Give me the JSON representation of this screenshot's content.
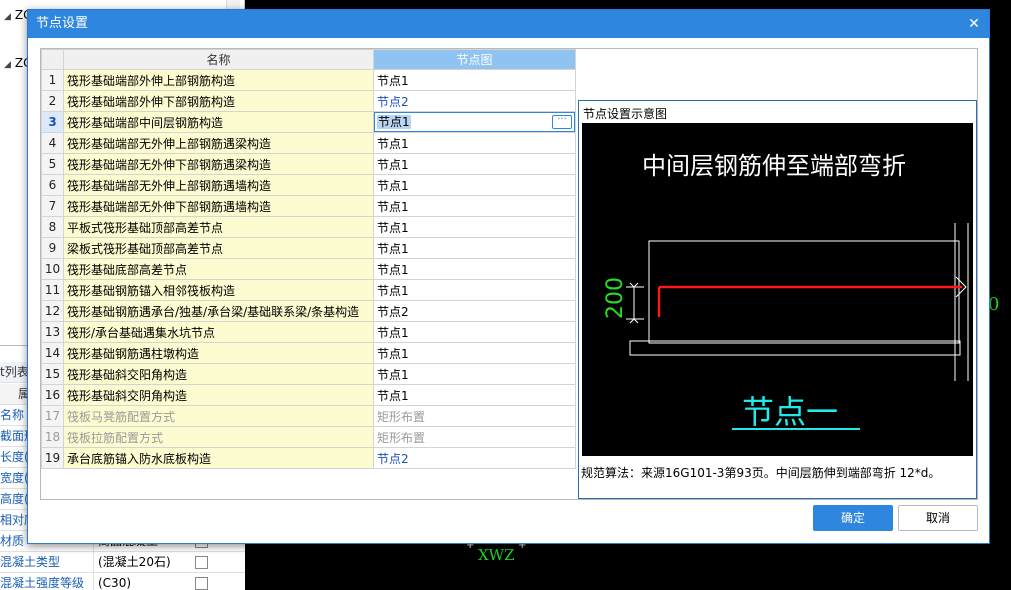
{
  "background": {
    "tree": [
      {
        "label": "ZC"
      },
      {
        "label": "ZC"
      }
    ],
    "panel_header": "t列表",
    "panel_col": "属",
    "rows": [
      {
        "name": "名称",
        "value": ""
      },
      {
        "name": "截面形",
        "value": ""
      },
      {
        "name": "长度(r",
        "value": ""
      },
      {
        "name": "宽度(r",
        "value": ""
      },
      {
        "name": "高度(r",
        "value": ""
      },
      {
        "name": "相对底",
        "value": ""
      },
      {
        "name": "材质",
        "value": "商品混凝土"
      },
      {
        "name": "混凝土类型",
        "value": "(混凝土20石)"
      },
      {
        "name": "混凝土强度等级",
        "value": "(C30)"
      }
    ],
    "canvas_label": "XWZ",
    "canvas_edge": "0"
  },
  "dialog": {
    "title": "节点设置",
    "close_icon": "close-icon",
    "columns": {
      "name": "名称",
      "node": "节点图"
    },
    "rows": [
      {
        "num": "1",
        "name": "筏形基础端部外伸上部钢筋构造",
        "node": "节点1",
        "style": "normal"
      },
      {
        "num": "2",
        "name": "筏形基础端部外伸下部钢筋构造",
        "node": "节点2",
        "style": "blue"
      },
      {
        "num": "3",
        "name": "筏形基础端部中间层钢筋构造",
        "node": "节点1",
        "style": "selected"
      },
      {
        "num": "4",
        "name": "筏形基础端部无外伸上部钢筋遇梁构造",
        "node": "节点1",
        "style": "normal"
      },
      {
        "num": "5",
        "name": "筏形基础端部无外伸下部钢筋遇梁构造",
        "node": "节点1",
        "style": "normal"
      },
      {
        "num": "6",
        "name": "筏形基础端部无外伸上部钢筋遇墙构造",
        "node": "节点1",
        "style": "normal"
      },
      {
        "num": "7",
        "name": "筏形基础端部无外伸下部钢筋遇墙构造",
        "node": "节点1",
        "style": "normal"
      },
      {
        "num": "8",
        "name": "平板式筏形基础顶部高差节点",
        "node": "节点1",
        "style": "normal"
      },
      {
        "num": "9",
        "name": "梁板式筏形基础顶部高差节点",
        "node": "节点1",
        "style": "normal"
      },
      {
        "num": "10",
        "name": "筏形基础底部高差节点",
        "node": "节点1",
        "style": "normal"
      },
      {
        "num": "11",
        "name": "筏形基础钢筋锚入相邻筏板构造",
        "node": "节点1",
        "style": "normal"
      },
      {
        "num": "12",
        "name": "筏形基础钢筋遇承台/独基/承台梁/基础联系梁/条基构造",
        "node": "节点2",
        "style": "normal"
      },
      {
        "num": "13",
        "name": "筏形/承台基础遇集水坑节点",
        "node": "节点1",
        "style": "normal"
      },
      {
        "num": "14",
        "name": "筏形基础钢筋遇柱墩构造",
        "node": "节点1",
        "style": "normal"
      },
      {
        "num": "15",
        "name": "筏形基础斜交阳角构造",
        "node": "节点1",
        "style": "normal"
      },
      {
        "num": "16",
        "name": "筏形基础斜交阴角构造",
        "node": "节点1",
        "style": "normal"
      },
      {
        "num": "17",
        "name": "筏板马凳筋配置方式",
        "node": "矩形布置",
        "style": "disabled"
      },
      {
        "num": "18",
        "name": "筏板拉筋配置方式",
        "node": "矩形布置",
        "style": "disabled"
      },
      {
        "num": "19",
        "name": "承台底筋锚入防水底板构造",
        "node": "节点2",
        "style": "blue"
      }
    ],
    "preview": {
      "title": "节点设置示意图",
      "drawing_title": "中间层钢筋伸至端部弯折",
      "dimension": "200",
      "node_label": "节点一",
      "formula": "规范算法：来源16G101-3第93页。中间层筋伸到端部弯折 12*d。",
      "colors": {
        "title": "#ffffff",
        "dim": "#22e022",
        "rebar": "#ff1a1a",
        "label": "#22e8e8",
        "outline": "#ffffff"
      }
    },
    "ok_label": "确定",
    "cancel_label": "取消",
    "accent": "#2e86de"
  }
}
